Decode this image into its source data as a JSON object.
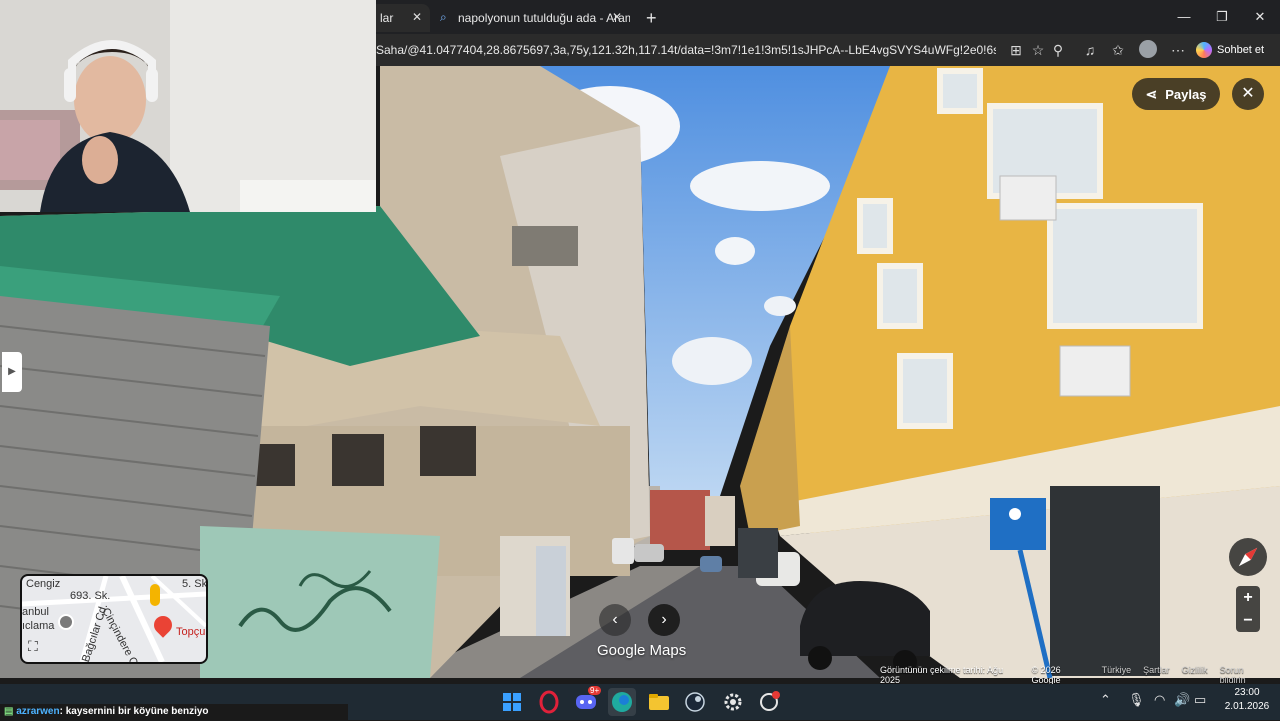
{
  "browser": {
    "tabs": [
      {
        "title": "lar",
        "active": true
      },
      {
        "title": "napolyonun tutulduğu ada - Aram",
        "active": false
      }
    ],
    "new_tab": "+",
    "url": "Saha/@41.0477404,28.8675697,3a,75y,121.32h,117.14t/data=!3m7!1e1!3m5!1sJHPcA--LbE4vgSVYS4uWFg!2e0!6shttps:...",
    "copilot_label": "Sohbet et",
    "window_controls": {
      "minimize": "—",
      "maximize": "❐",
      "close": "✕"
    }
  },
  "streetview": {
    "share_label": "Paylaş",
    "close_label": "✕",
    "brand": "Google Maps",
    "footer": {
      "capture_date": "Görüntünün çekilme tarihi: Ağu 2025",
      "copyright": "© 2026 Google",
      "country": "Türkiye",
      "terms": "Şartlar",
      "privacy": "Gizlilik",
      "report": "Sorun bildirin"
    },
    "zoom": {
      "in": "+",
      "out": "−"
    },
    "minimap": {
      "street_1": "693. Sk.",
      "street_2": "Çinçindere Cd.",
      "street_3": "Bağcılar Cd.",
      "label_left_1": "anbul",
      "label_left_2": "ıclama",
      "place": "Topçu",
      "top_left": "Cengiz",
      "top_right": "5. Sk."
    },
    "sign_text": "ENGELLI PARK YERI"
  },
  "chat": {
    "user": "azrarwen",
    "message": ": kaysernini bir köyüne benziyo"
  },
  "taskbar": {
    "time": "23:00",
    "date": "2.01.2026",
    "discord_badge": "9+"
  }
}
